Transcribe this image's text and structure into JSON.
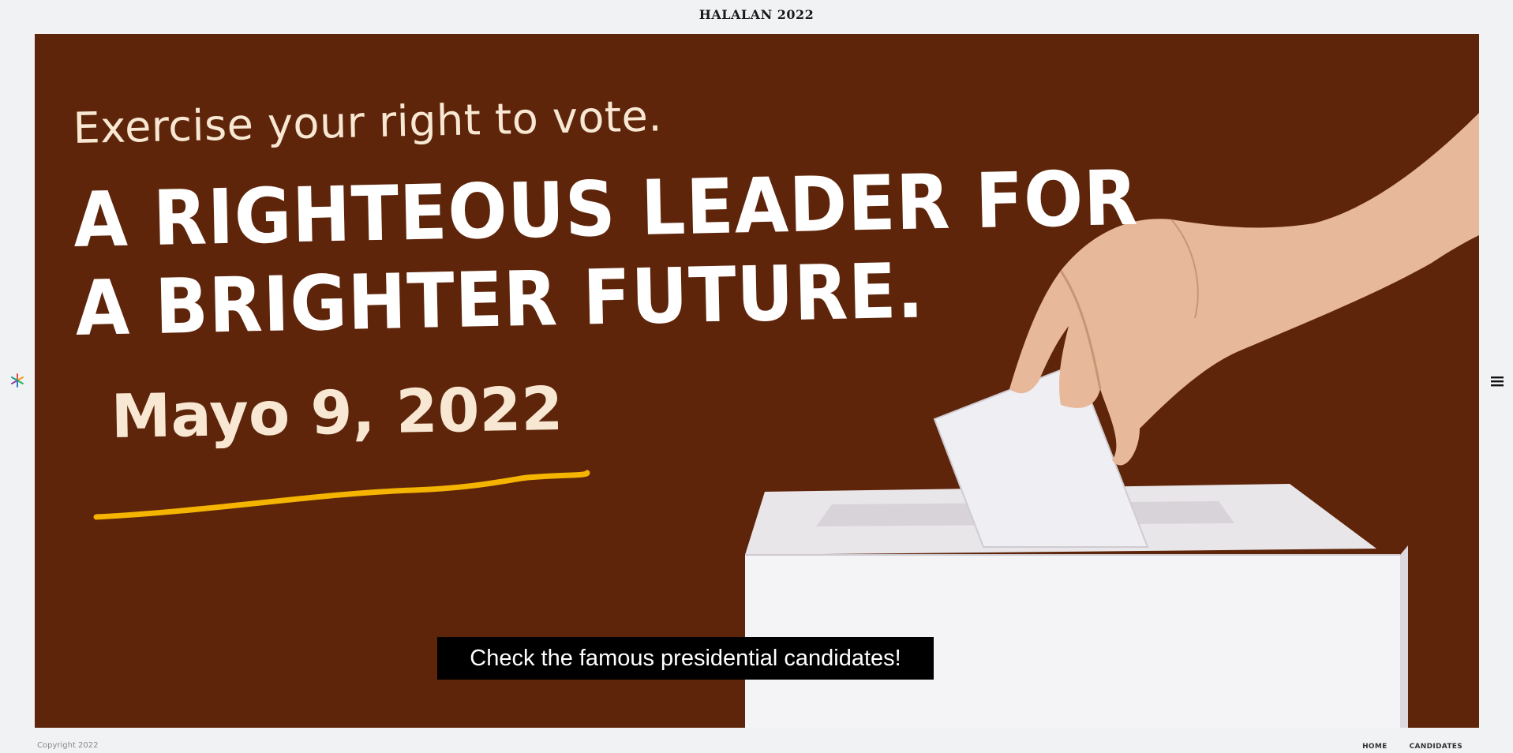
{
  "header": {
    "title": "HALALAN 2022"
  },
  "icons": {
    "logo": "spark-logo-icon",
    "menu": "hamburger-menu-icon"
  },
  "hero": {
    "tagline": "Exercise your right to vote.",
    "headline_line1": "A RIGHTEOUS LEADER FOR",
    "headline_line2": "A BRIGHTER FUTURE.",
    "date": "Mayo 9, 2022",
    "cta_label": "Check the famous presidential candidates!"
  },
  "footer": {
    "copyright": "Copyright 2022",
    "nav": {
      "home": "HOME",
      "candidates": "CANDIDATES"
    }
  },
  "colors": {
    "hero_background": "#5e250a",
    "accent_underline": "#f5b400",
    "cream_text": "#f8e8d3",
    "page_background": "#f1f2f4"
  }
}
